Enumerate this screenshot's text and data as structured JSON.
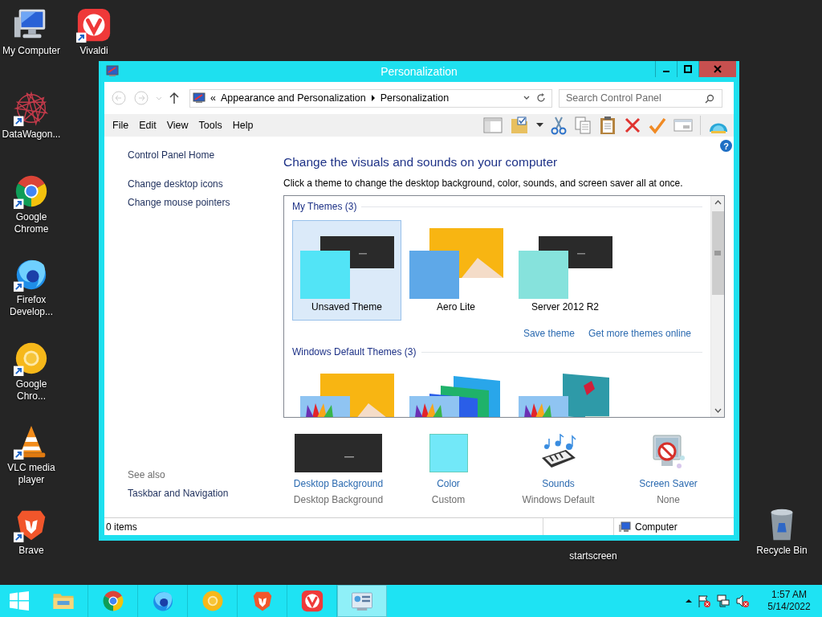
{
  "desktop_icons": [
    {
      "label": "My Computer",
      "kind": "computer",
      "shortcut": false
    },
    {
      "label": "Vivaldi",
      "kind": "vivaldi",
      "shortcut": true
    },
    {
      "label": "DataWagon...",
      "kind": "datawagon",
      "shortcut": true
    },
    {
      "label": "Google Chrome",
      "kind": "chrome",
      "shortcut": true
    },
    {
      "label": "Firefox Develop...",
      "kind": "firefox",
      "shortcut": true
    },
    {
      "label": "Google Chro...",
      "kind": "canary",
      "shortcut": true
    },
    {
      "label": "VLC media player",
      "kind": "vlc",
      "shortcut": true
    },
    {
      "label": "Brave",
      "kind": "brave",
      "shortcut": true
    },
    {
      "label": "startscreen",
      "kind": "hidden"
    },
    {
      "label": "Recycle Bin",
      "kind": "recycle",
      "shortcut": false
    }
  ],
  "window": {
    "title": "Personalization",
    "address": {
      "overflow": "«",
      "crumbs": [
        "Appearance and Personalization",
        "Personalization"
      ]
    },
    "search": {
      "placeholder": "Search Control Panel"
    },
    "menu": [
      "File",
      "Edit",
      "View",
      "Tools",
      "Help"
    ],
    "help": "?",
    "sidebar": {
      "links": [
        "Control Panel Home",
        "Change desktop icons",
        "Change mouse pointers"
      ],
      "see_also_title": "See also",
      "see_also": [
        "Taskbar and Navigation"
      ]
    },
    "heading": "Change the visuals and sounds on your computer",
    "subtitle": "Click a theme to change the desktop background, color, sounds, and screen saver all at once.",
    "theme_groups": [
      {
        "title": "My Themes (3)",
        "themes": [
          {
            "name": "Unsaved Theme",
            "selected": true,
            "kind": "dark",
            "color": "#52e4f6"
          },
          {
            "name": "Aero Lite",
            "selected": false,
            "kind": "orange",
            "color": "#5ea8e8"
          },
          {
            "name": "Server 2012 R2",
            "selected": false,
            "kind": "dark",
            "color": "#86e2dc"
          }
        ],
        "links": [
          "Save theme",
          "Get more themes online"
        ]
      },
      {
        "title": "Windows Default Themes (3)",
        "themes": [
          {
            "selected": false,
            "kind": "orange",
            "color": "#8fc4f2",
            "palette": true
          },
          {
            "selected": false,
            "kind": "panels",
            "color": "#8fc4f2",
            "palette": true
          },
          {
            "selected": false,
            "kind": "flower",
            "color": "#8fc4f2",
            "palette": true
          }
        ]
      }
    ],
    "settings": [
      {
        "label": "Desktop Background",
        "value": "Desktop Background",
        "kind": "wallpaper"
      },
      {
        "label": "Color",
        "value": "Custom",
        "kind": "color"
      },
      {
        "label": "Sounds",
        "value": "Windows Default",
        "kind": "sounds"
      },
      {
        "label": "Screen Saver",
        "value": "None",
        "kind": "screensaver"
      }
    ],
    "status_bar": {
      "items": "0 items",
      "location": "Computer"
    }
  },
  "taskbar": {
    "apps": [
      {
        "kind": "folder",
        "selected": false
      },
      {
        "kind": "chrome",
        "selected": false
      },
      {
        "kind": "firefox",
        "selected": false
      },
      {
        "kind": "canary",
        "selected": false
      },
      {
        "kind": "brave",
        "selected": false
      },
      {
        "kind": "vivaldi",
        "selected": false
      },
      {
        "kind": "controlpanel",
        "selected": true
      }
    ],
    "clock": {
      "time": "1:57 AM",
      "date": "5/14/2022"
    }
  }
}
